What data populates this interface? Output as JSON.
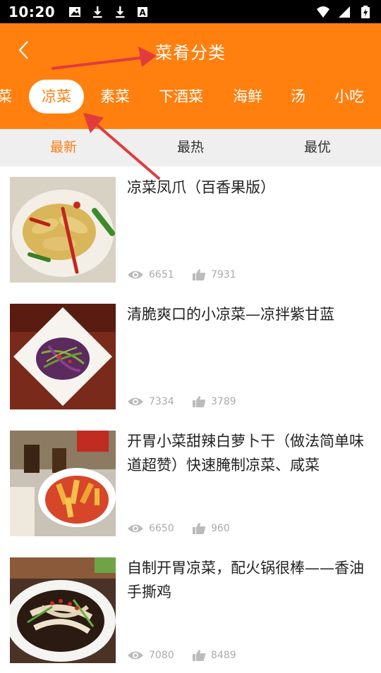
{
  "status_bar": {
    "time": "10:20",
    "left_icons": [
      "image-icon",
      "download-icon",
      "download-icon",
      "a-letter-icon"
    ],
    "right_icons": [
      "wifi-icon",
      "signal-icon",
      "battery-charging-icon"
    ]
  },
  "header": {
    "title": "菜肴分类",
    "back_icon": "chevron-left-icon",
    "background_color": "#FF7F0F"
  },
  "category_tabs": [
    {
      "label": "菜",
      "active": false
    },
    {
      "label": "凉菜",
      "active": true
    },
    {
      "label": "素菜",
      "active": false
    },
    {
      "label": "下酒菜",
      "active": false
    },
    {
      "label": "海鲜",
      "active": false
    },
    {
      "label": "汤",
      "active": false
    },
    {
      "label": "小吃",
      "active": false
    }
  ],
  "sort_tabs": [
    {
      "label": "最新",
      "active": true
    },
    {
      "label": "最热",
      "active": false
    },
    {
      "label": "最优",
      "active": false
    }
  ],
  "recipes": [
    {
      "title": "凉菜凤爪（百香果版）",
      "views": "6651",
      "likes": "7931"
    },
    {
      "title": "清脆爽口的小凉菜—凉拌紫甘蓝",
      "views": "7334",
      "likes": "3789"
    },
    {
      "title": "开胃小菜甜辣白萝卜干（做法简单味道超赞）快速腌制凉菜、咸菜",
      "views": "6650",
      "likes": "960"
    },
    {
      "title": "自制开胃凉菜，配火锅很棒——香油手撕鸡",
      "views": "7080",
      "likes": "8489"
    }
  ],
  "colors": {
    "accent": "#FF7F0F",
    "annotation_arrow": "#E03C3C"
  }
}
